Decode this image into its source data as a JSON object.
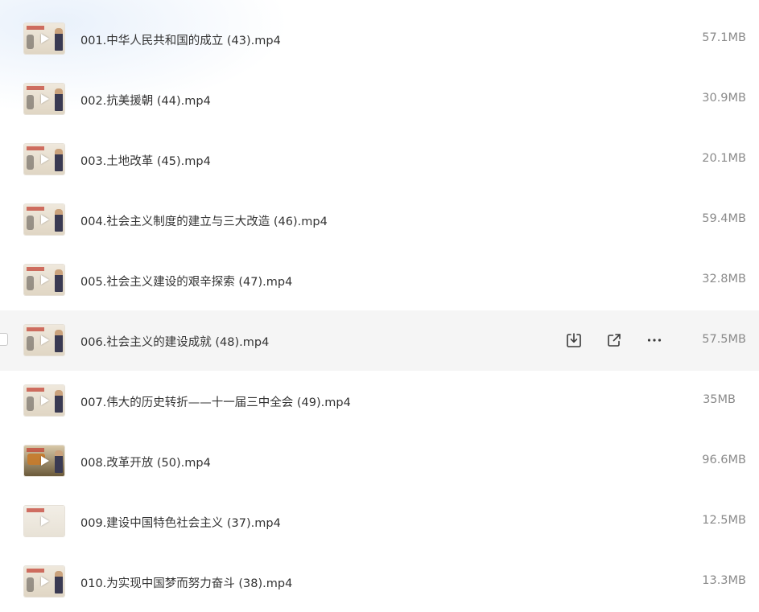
{
  "files": [
    {
      "name": "001.中华人民共和国的成立 (43).mp4",
      "size": "57.1MB"
    },
    {
      "name": "002.抗美援朝 (44).mp4",
      "size": "30.9MB"
    },
    {
      "name": "003.土地改革 (45).mp4",
      "size": "20.1MB"
    },
    {
      "name": "004.社会主义制度的建立与三大改造 (46).mp4",
      "size": "59.4MB"
    },
    {
      "name": "005.社会主义建设的艰辛探索 (47).mp4",
      "size": "32.8MB"
    },
    {
      "name": "006.社会主义的建设成就 (48).mp4",
      "size": "57.5MB"
    },
    {
      "name": "007.伟大的历史转折——十一届三中全会 (49).mp4",
      "size": "35MB"
    },
    {
      "name": "008.改革开放 (50).mp4",
      "size": "96.6MB"
    },
    {
      "name": "009.建设中国特色社会主义 (37).mp4",
      "size": "12.5MB"
    },
    {
      "name": "010.为实现中国梦而努力奋斗 (38).mp4",
      "size": "13.3MB"
    }
  ],
  "hover_actions": {
    "download_icon": "download-icon",
    "share_icon": "share-icon",
    "more_icon": "more-icon"
  },
  "colors": {
    "hover_row": "#f5f5f5",
    "filename": "#333333",
    "size": "#8a8a8a"
  }
}
